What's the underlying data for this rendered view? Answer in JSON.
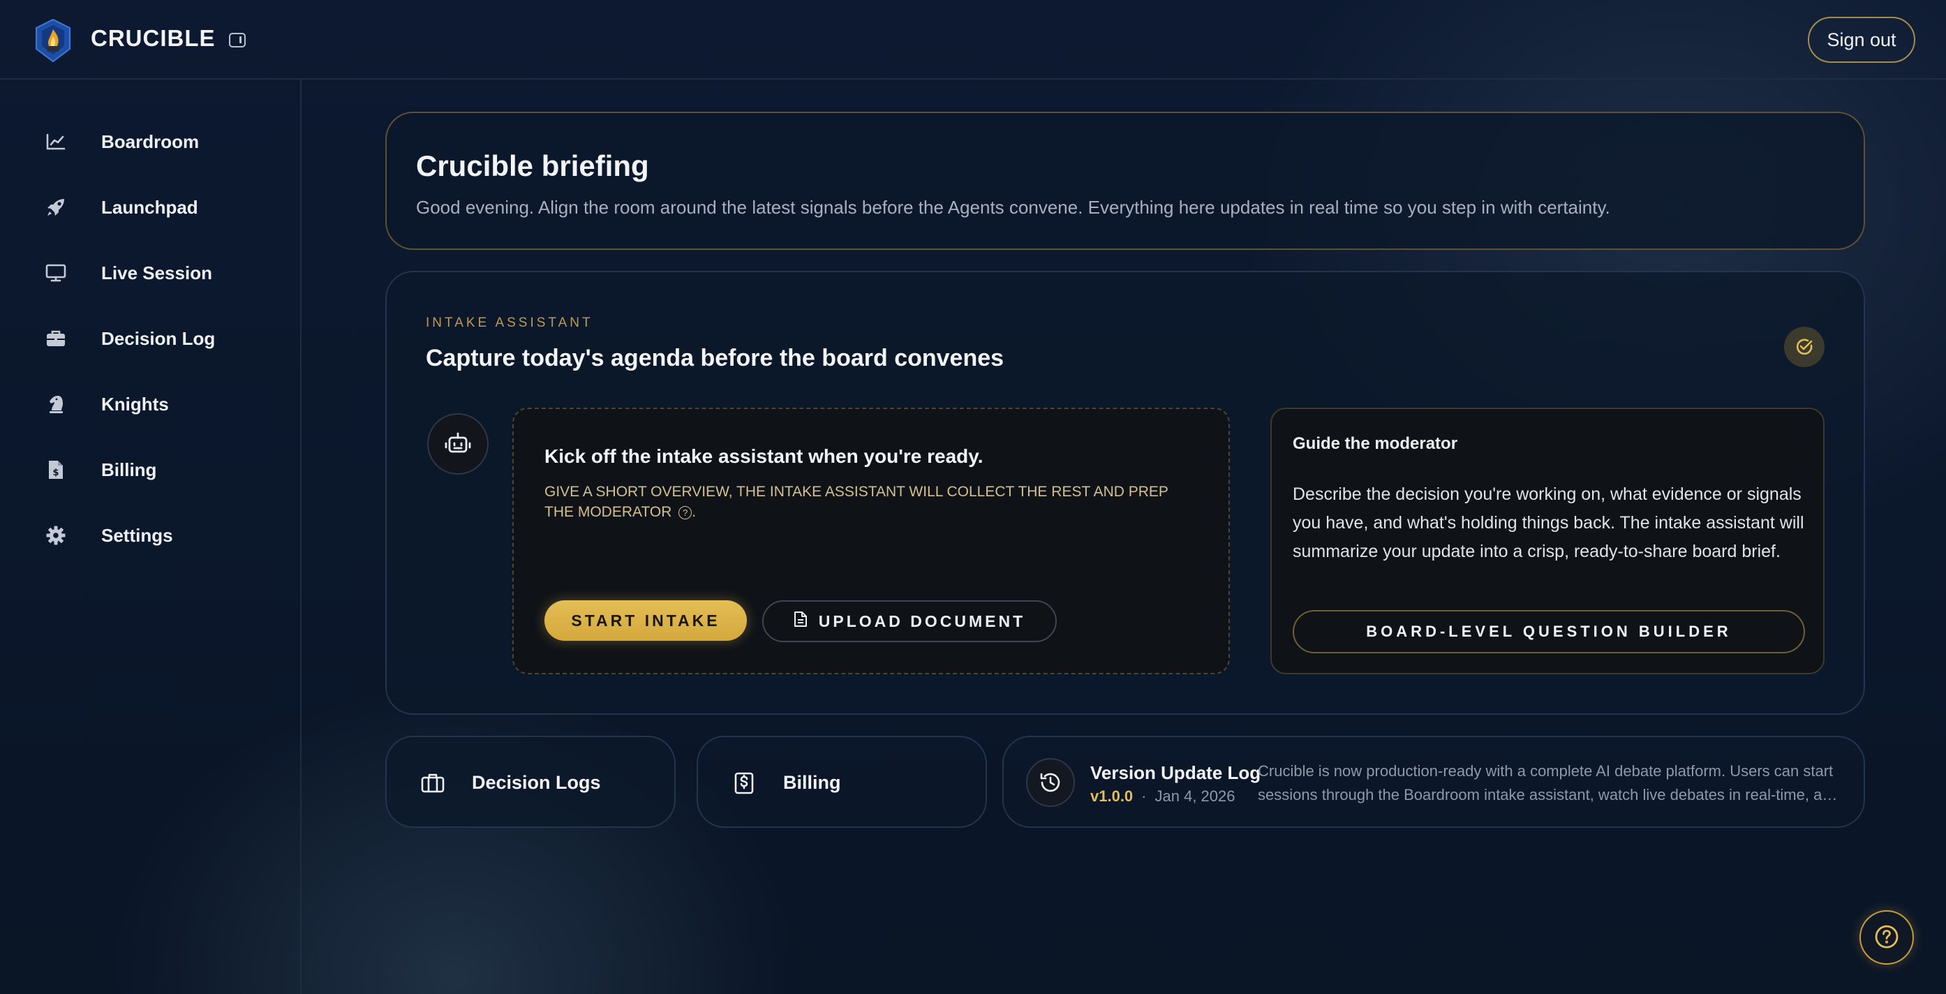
{
  "app": {
    "brand": "CRUCIBLE",
    "sign_out_label": "Sign out",
    "accent_color": "#e3bd55",
    "logo_icon": "crucible-flame-logo"
  },
  "sidebar": {
    "items": [
      {
        "label": "Boardroom",
        "icon": "chart-line-icon"
      },
      {
        "label": "Launchpad",
        "icon": "rocket-icon"
      },
      {
        "label": "Live Session",
        "icon": "monitor-icon"
      },
      {
        "label": "Decision Log",
        "icon": "briefcase-icon"
      },
      {
        "label": "Knights",
        "icon": "chess-knight-icon"
      },
      {
        "label": "Billing",
        "icon": "invoice-dollar-icon"
      },
      {
        "label": "Settings",
        "icon": "gear-icon"
      }
    ]
  },
  "briefing": {
    "title": "Crucible briefing",
    "subtitle": "Good evening. Align the room around the latest signals before the Agents convene. Everything here updates in real time so you step in with certainty."
  },
  "intake": {
    "eyebrow": "INTAKE ASSISTANT",
    "title": "Capture today's agenda before the board convenes",
    "kickoff": {
      "title": "Kick off the intake assistant when you're ready.",
      "hint": "Give a short overview, the intake assistant will collect the rest and prep the moderator",
      "hint_suffix": ".",
      "start_label": "START INTAKE",
      "upload_label": "UPLOAD DOCUMENT"
    },
    "guide": {
      "title": "Guide the moderator",
      "body": "Describe the decision you're working on, what evidence or signals you have, and what's holding things back. The intake assistant will summarize your update into a crisp, ready-to-share board brief.",
      "button_label": "BOARD-LEVEL QUESTION BUILDER"
    }
  },
  "quick_links": [
    {
      "label": "Decision Logs",
      "icon": "briefcase-icon"
    },
    {
      "label": "Billing",
      "icon": "dollar-doc-icon"
    }
  ],
  "version_log": {
    "title": "Version Update Log",
    "version": "v1.0.0",
    "date": "Jan 4, 2026",
    "line1": "Crucible is now production-ready with a complete AI debate platform. Users can start",
    "line2": "sessions through the Boardroom intake assistant, watch live debates in real-time, and..."
  }
}
